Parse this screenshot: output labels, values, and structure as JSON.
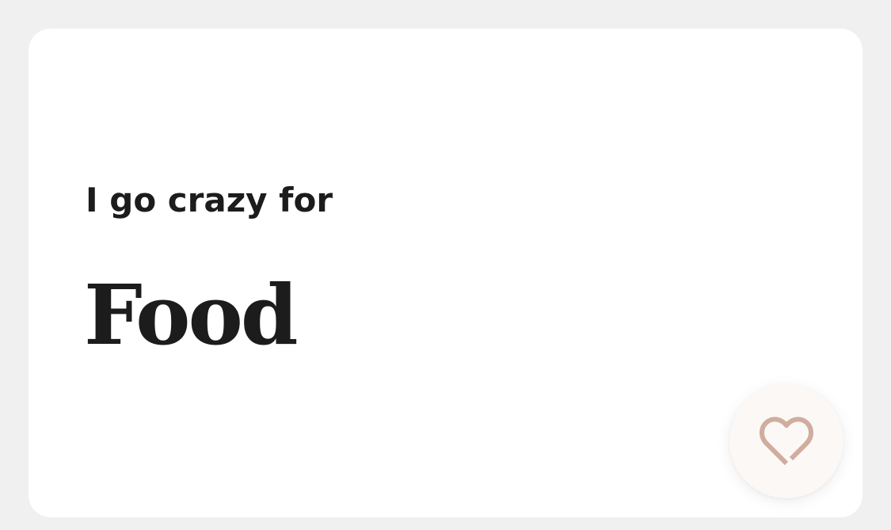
{
  "card": {
    "prompt": "I go crazy for",
    "answer": "Food"
  },
  "like_button": {
    "icon": "heart-outline-icon",
    "color": "#cfae9f"
  }
}
